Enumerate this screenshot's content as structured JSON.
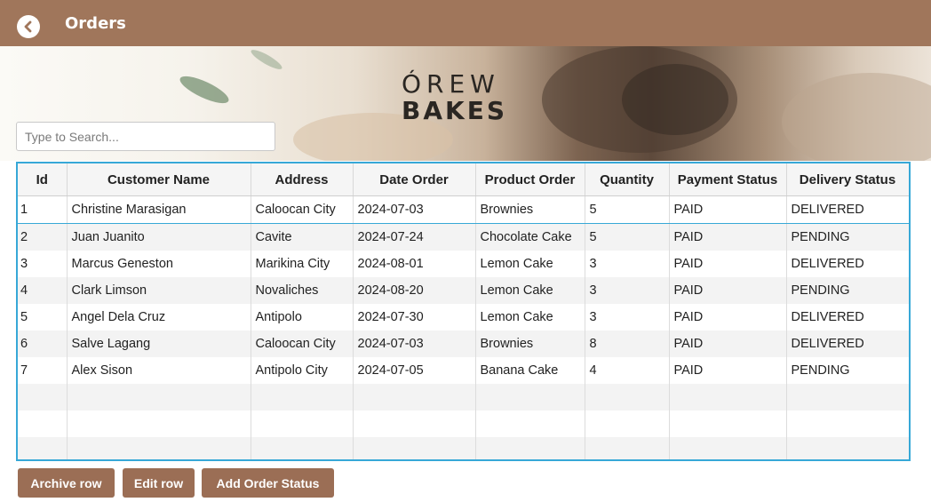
{
  "header": {
    "title": "Orders"
  },
  "banner": {
    "logo_line1": "ÓREW",
    "logo_line2": "BAKES"
  },
  "search": {
    "placeholder": "Type to Search...",
    "value": ""
  },
  "table": {
    "columns": [
      "Id",
      "Customer Name",
      "Address",
      "Date Order",
      "Product Order",
      "Quantity",
      "Payment Status",
      "Delivery Status"
    ],
    "rows": [
      [
        "1",
        "Christine Marasigan",
        "Caloocan City",
        "2024-07-03",
        "Brownies",
        "5",
        "PAID",
        "DELIVERED"
      ],
      [
        "2",
        "Juan Juanito",
        "Cavite",
        "2024-07-24",
        "Chocolate Cake",
        "5",
        "PAID",
        "PENDING"
      ],
      [
        "3",
        "Marcus Geneston",
        "Marikina City",
        "2024-08-01",
        "Lemon Cake",
        "3",
        "PAID",
        "DELIVERED"
      ],
      [
        "4",
        "Clark Limson",
        "Novaliches",
        "2024-08-20",
        "Lemon Cake",
        "3",
        "PAID",
        "PENDING"
      ],
      [
        "5",
        "Angel Dela Cruz",
        "Antipolo",
        "2024-07-30",
        "Lemon Cake",
        "3",
        "PAID",
        "DELIVERED"
      ],
      [
        "6",
        "Salve Lagang",
        "Caloocan City",
        "2024-07-03",
        "Brownies",
        "8",
        "PAID",
        "DELIVERED"
      ],
      [
        "7",
        "Alex Sison",
        "Antipolo City",
        "2024-07-05",
        "Banana Cake",
        "4",
        "PAID",
        "PENDING"
      ]
    ],
    "selected_row": 0
  },
  "actions": {
    "archive_label": "Archive row",
    "edit_label": "Edit row",
    "add_status_label": "Add Order Status"
  },
  "colors": {
    "header_bg": "#a0765b",
    "button_bg": "#9b6e55",
    "selection_border": "#37a8d7"
  },
  "icons": {
    "back": "back-arrow-icon"
  }
}
